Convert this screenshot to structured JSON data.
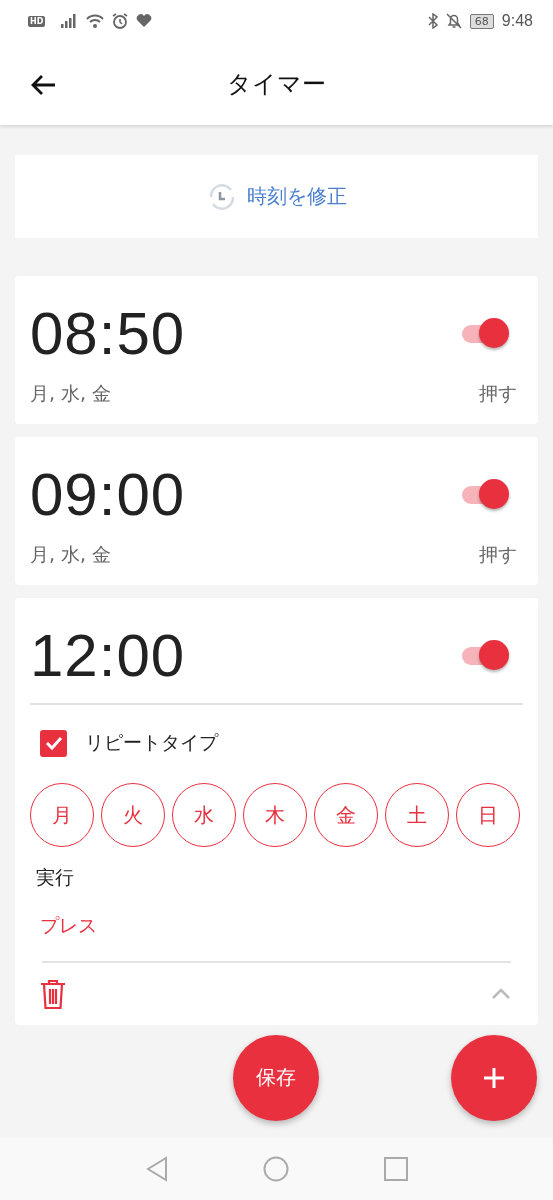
{
  "status_bar": {
    "badge": "HD",
    "battery": "68",
    "time": "9:48"
  },
  "header": {
    "title": "タイマー"
  },
  "fix_time": {
    "label": "時刻を修正"
  },
  "alarms": [
    {
      "time": "08:50",
      "on": true,
      "expanded": false,
      "days": "月, 水, 金",
      "action": "押す"
    },
    {
      "time": "09:00",
      "on": true,
      "expanded": false,
      "days": "月, 水, 金",
      "action": "押す"
    },
    {
      "time": "12:00",
      "on": true,
      "expanded": true,
      "repeat": {
        "label": "リピートタイプ",
        "checked": true
      },
      "weekdays": [
        {
          "label": "月",
          "selected": false
        },
        {
          "label": "火",
          "selected": false
        },
        {
          "label": "水",
          "selected": false
        },
        {
          "label": "木",
          "selected": false
        },
        {
          "label": "金",
          "selected": false
        },
        {
          "label": "土",
          "selected": false
        },
        {
          "label": "日",
          "selected": false
        }
      ],
      "action_label": "実行",
      "action": "プレス"
    }
  ],
  "save_button": "保存"
}
